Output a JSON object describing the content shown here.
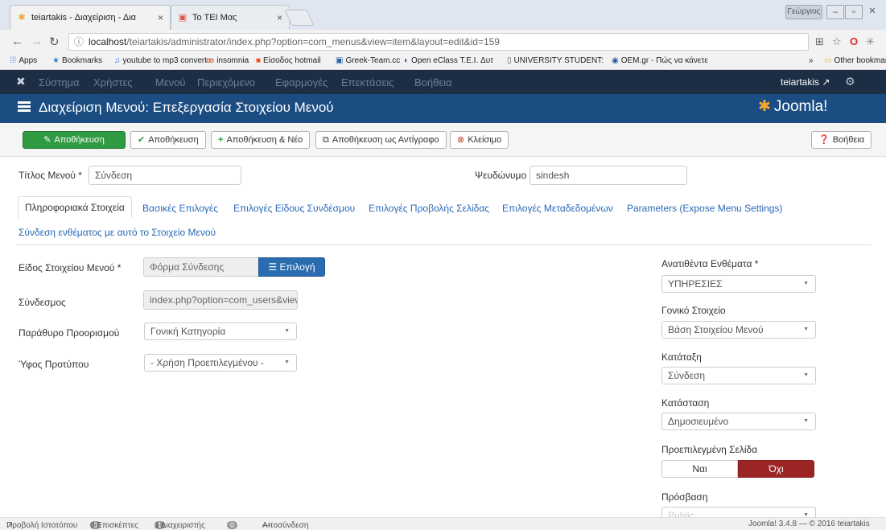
{
  "browser": {
    "tabs": [
      {
        "title": "teiartakis - Διαχείριση - Δια"
      },
      {
        "title": "Το ΤΕΙ Μας"
      }
    ],
    "profile": "Γεώργιος",
    "url_host": "localhost",
    "url_path": "/teiartakis/administrator/index.php?option=com_menus&view=item&layout=edit&id=159",
    "bookmarks": [
      "Apps",
      "Bookmarks",
      "youtube to mp3 convert",
      "insomnia",
      "Είσοδος hotmail",
      "Greek-Team.cc",
      "Open eClass T.E.I. Δυτ",
      "UNIVERSITY STUDENT:",
      "OEM.gr - Πώς να κάνετε"
    ],
    "bookmarks_overflow": "»",
    "other_bookmarks": "Other bookmarks"
  },
  "joomla_nav": {
    "items": [
      "Σύστημα",
      "Χρήστες",
      "Μενού",
      "Περιεχόμενο",
      "Εφαρμογές",
      "Επεκτάσεις",
      "Βοήθεια"
    ],
    "user": "teiartakis"
  },
  "header": {
    "title": "Διαχείριση Μενού: Επεξεργασία Στοιχείου Μενού",
    "brand": "Joomla!"
  },
  "toolbar": {
    "save_primary": "Αποθήκευση",
    "save": "Αποθήκευση",
    "save_new": "Αποθήκευση & Νέο",
    "save_copy": "Αποθήκευση ως Αντίγραφο",
    "close": "Κλείσιμο",
    "help": "Βοήθεια"
  },
  "form": {
    "title_label": "Τίτλος Μενού *",
    "title_value": "Σύνδεση",
    "alias_label": "Ψευδώνυμο",
    "alias_value": "sindesh",
    "tabs": [
      "Πληροφοριακά Στοιχεία",
      "Βασικές Επιλογές",
      "Επιλογές Είδους Συνδέσμου",
      "Επιλογές Προβολής Σελίδας",
      "Επιλογές Μεταδεδομένων",
      "Parameters (Expose Menu Settings)",
      "Σύνδεση ενθέματος με αυτό το Στοιχείο Μενού"
    ],
    "item_type_label": "Είδος Στοιχείου Μενού *",
    "item_type_value": "Φόρμα Σύνδεσης",
    "choose_button": "Επιλογή",
    "link_label": "Σύνδεσμος",
    "link_value": "index.php?option=com_users&view",
    "target_label": "Παράθυρο Προορισμού",
    "target_value": "Γονική Κατηγορία",
    "template_label": "Ύφος Προτύπου",
    "template_value": "- Χρήση Προεπιλεγμένου -"
  },
  "sidebar": {
    "menu_label": "Ανατιθέντα Ενθέματα *",
    "menu_value": "ΥΠΗΡΕΣΙΕΣ",
    "parent_label": "Γονικό Στοιχείο",
    "parent_value": "Βάση Στοιχείου Μενού",
    "order_label": "Κατάταξη",
    "order_value": "Σύνδεση",
    "status_label": "Κατάσταση",
    "status_value": "Δημοσιευμένο",
    "default_label": "Προεπιλεγμένη Σελίδα",
    "yes": "Ναι",
    "no": "Όχι",
    "access_label": "Πρόσβαση",
    "access_value": "Public"
  },
  "statusbar": {
    "view_site": "Προβολή Ιστοτόπου",
    "visitors_count": "0",
    "visitors": "0 Επισκέπτες",
    "admins_count": "1",
    "admins": "1 Διαχειριστής",
    "messages_count": "0",
    "logout": "Αποσύνδεση",
    "version": "Joomla! 3.4.8 — © 2016 teiartakis"
  }
}
